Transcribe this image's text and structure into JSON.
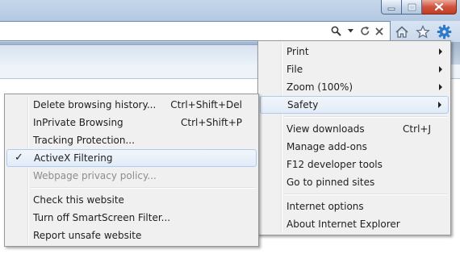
{
  "toolbar": {
    "icons": [
      "search-icon",
      "dropdown-icon",
      "refresh-icon",
      "stop-icon",
      "home-icon",
      "favorites-icon",
      "tools-gear-icon"
    ]
  },
  "tools_menu": {
    "items": [
      {
        "label": "Print",
        "submenu": true
      },
      {
        "label": "File",
        "submenu": true
      },
      {
        "label": "Zoom (100%)",
        "submenu": true
      },
      {
        "label": "Safety",
        "submenu": true,
        "highlighted": true
      },
      {
        "label": "View downloads",
        "shortcut": "Ctrl+J"
      },
      {
        "label": "Manage add-ons"
      },
      {
        "label": "F12 developer tools"
      },
      {
        "label": "Go to pinned sites"
      },
      {
        "label": "Internet options"
      },
      {
        "label": "About Internet Explorer"
      }
    ]
  },
  "safety_menu": {
    "items": [
      {
        "label": "Delete browsing history...",
        "shortcut": "Ctrl+Shift+Del"
      },
      {
        "label": "InPrivate Browsing",
        "shortcut": "Ctrl+Shift+P"
      },
      {
        "label": "Tracking Protection..."
      },
      {
        "label": "ActiveX Filtering",
        "checked": true,
        "highlighted": true,
        "check_mark": "✓"
      },
      {
        "label": "Webpage privacy policy...",
        "disabled": true
      },
      {
        "label": "Check this website"
      },
      {
        "label": "Turn off SmartScreen Filter..."
      },
      {
        "label": "Report unsafe website"
      }
    ]
  },
  "colors": {
    "menu_bg": "#f0f0f0",
    "highlight_border": "#aeccf0",
    "disabled_text": "#8d8d8d",
    "close_button": "#c8432b",
    "gear_icon": "#2f79c8"
  }
}
